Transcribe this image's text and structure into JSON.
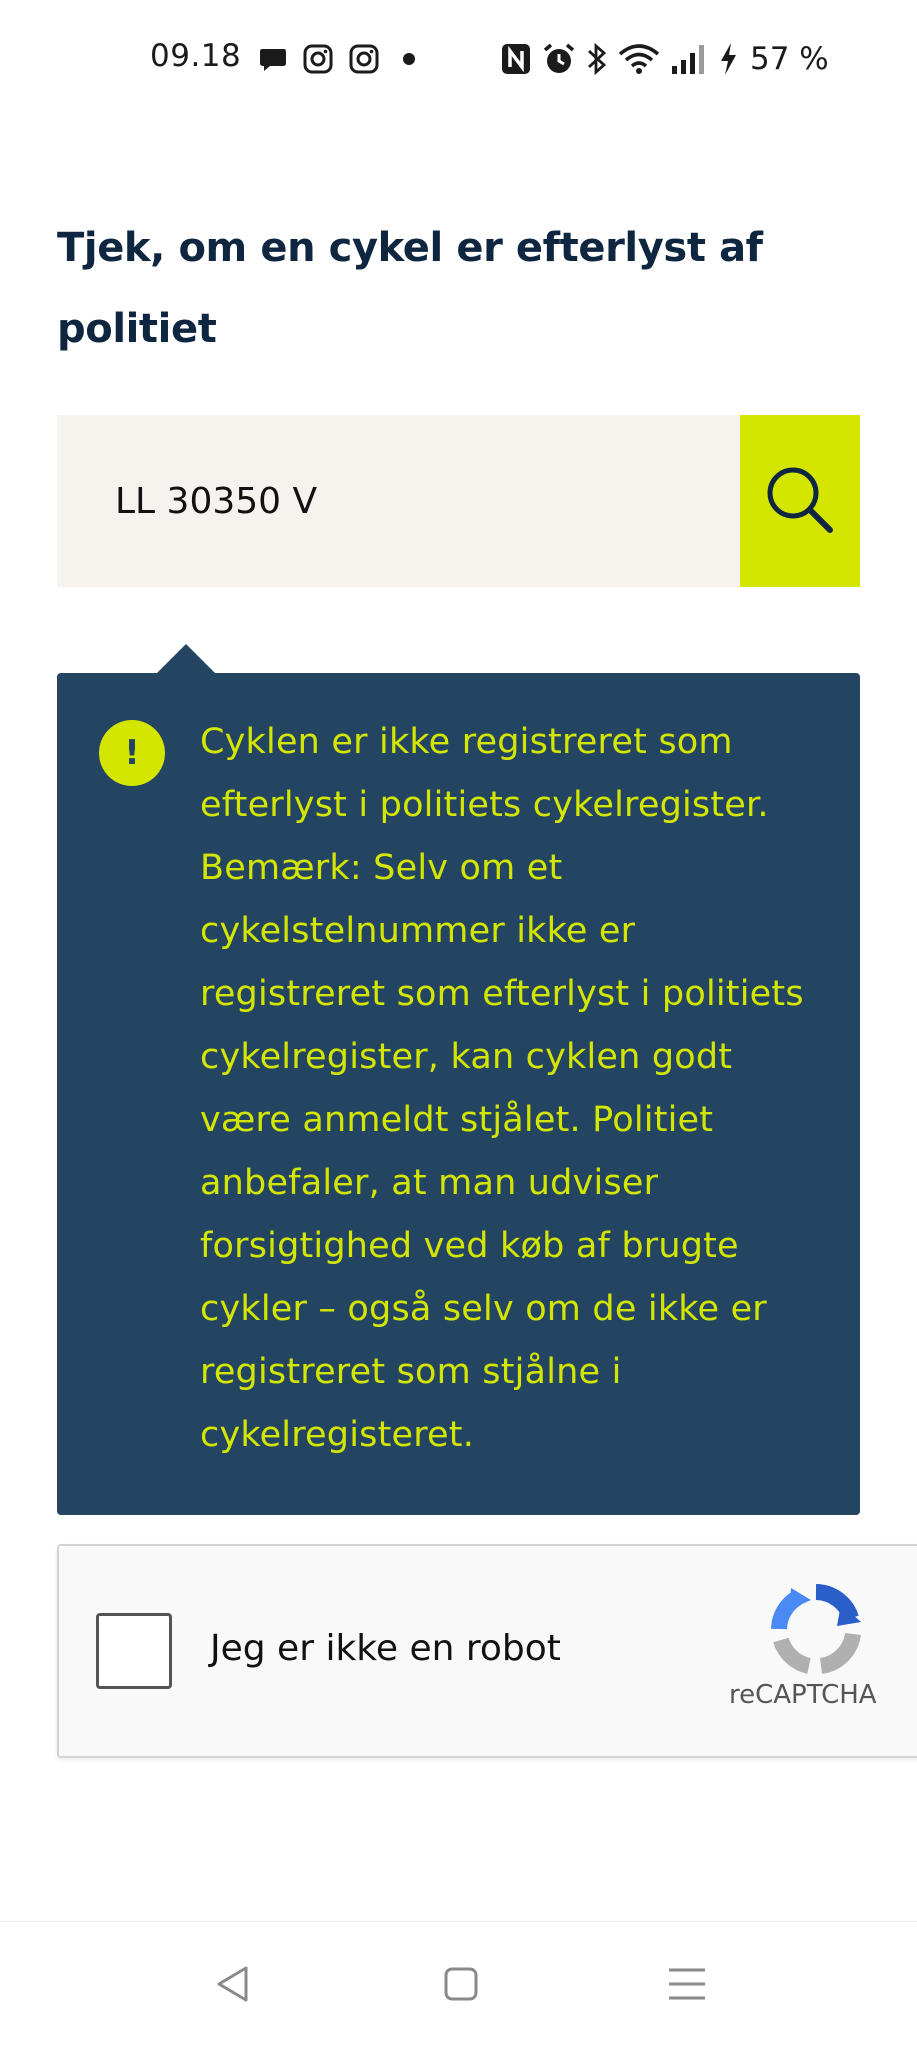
{
  "status_bar": {
    "time": "09.18",
    "battery": "57 %",
    "left_icons": [
      "chat-bubble-icon",
      "instagram-icon",
      "instagram-icon",
      "dot-icon"
    ],
    "right_icons": [
      "nfc-icon",
      "alarm-icon",
      "bluetooth-icon",
      "wifi-icon",
      "signal-icon",
      "charging-icon"
    ]
  },
  "page": {
    "title": "Tjek, om en cykel er efterlyst af politiet"
  },
  "search": {
    "value": "LL 30350 V",
    "button_icon": "search-icon"
  },
  "result": {
    "icon": "exclamation-icon",
    "icon_text": "!",
    "message": "Cyklen er ikke registreret som efterlyst i politiets cykelregister. Bemærk: Selv om et cykelstelnummer ikke er registreret som efterlyst i politiets cykelregister, kan cyklen godt være anmeldt stjålet. Politiet anbefaler, at man udviser forsigtighed ved køb af brugte cykler – også selv om de ikke er registreret som stjålne i cykelregisteret."
  },
  "captcha": {
    "label": "Jeg er ikke en robot",
    "brand": "reCAPTCHA",
    "checked": false
  },
  "nav_bar": {
    "buttons": [
      "back-icon",
      "home-icon",
      "menu-icon"
    ]
  },
  "colors": {
    "accent": "#d4e600",
    "panel": "#244562",
    "title": "#0f2640",
    "input_bg": "#f6f3ee"
  }
}
